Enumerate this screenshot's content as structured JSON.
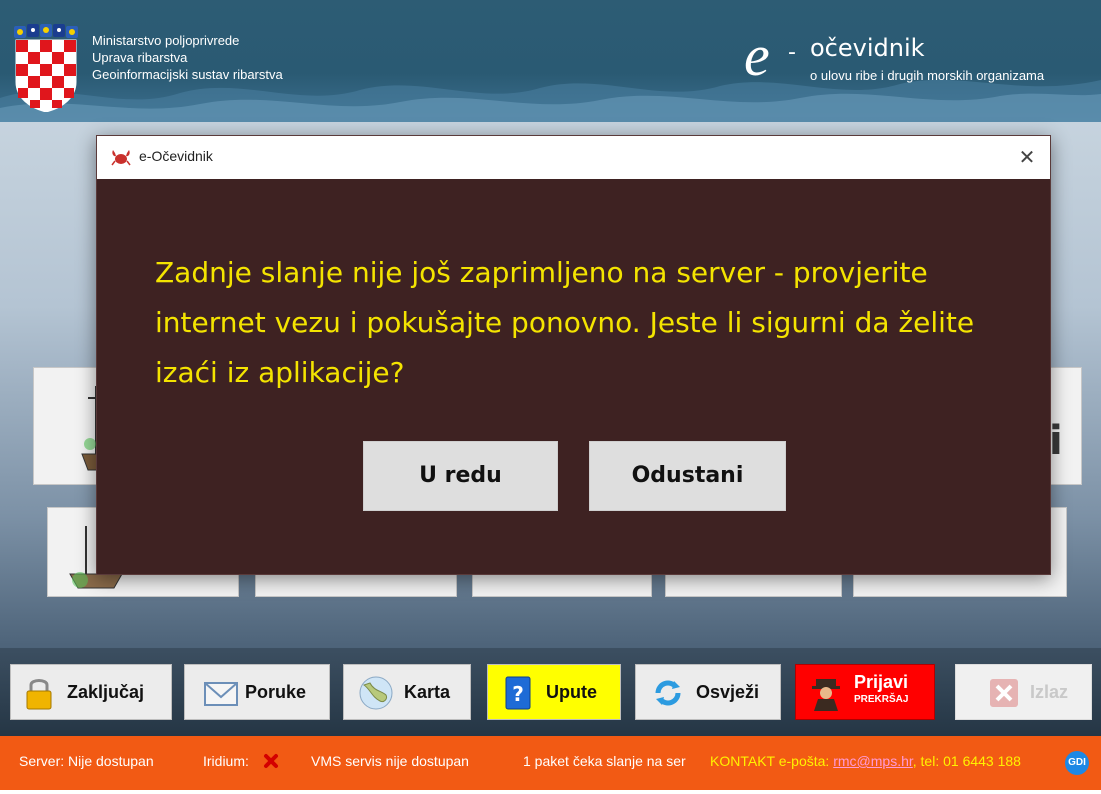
{
  "header": {
    "ministry_lines": [
      "Ministarstvo poljoprivrede",
      "Uprava ribarstva",
      "Geoinformacijski sustav ribarstva"
    ],
    "brand_letter": "e",
    "brand_dash": "-",
    "brand_name": "očevidnik",
    "brand_subtitle": "o ulovu ribe i drugih morskih organizama"
  },
  "background_tiles": {
    "partial_label": "i"
  },
  "dialog": {
    "title": "e-Očevidnik",
    "close_glyph": "✕",
    "message": "Zadnje slanje nije još zaprimljeno na server - provjerite internet vezu i pokušajte ponovno. Jeste li sigurni da želite izaći iz aplikacije?",
    "ok_label": "U redu",
    "cancel_label": "Odustani"
  },
  "toolbar": {
    "lock_label": "Zaključaj",
    "messages_label": "Poruke",
    "map_label": "Karta",
    "help_label": "Upute",
    "refresh_label": "Osvježi",
    "report_label": "Prijavi",
    "report_sublabel": "PREKRŠAJ",
    "exit_label": "Izlaz"
  },
  "status": {
    "server": "Server: Nije dostupan",
    "iridium": "Iridium:",
    "vms": "VMS servis nije dostupan",
    "pending": "1 paket čeka slanje na ser",
    "contact_prefix": "KONTAKT e-pošta: ",
    "contact_email": "rmc@mps.hr",
    "contact_suffix": ", tel: 01 6443 188",
    "gdi_badge": "GDI"
  },
  "colors": {
    "header_bg": "#2a5a73",
    "dialog_bg": "#3e2222",
    "dialog_text": "#f4e400",
    "status_bg": "#f25a14",
    "help_button_bg": "#ffff00",
    "report_button_bg": "#ff0000"
  }
}
